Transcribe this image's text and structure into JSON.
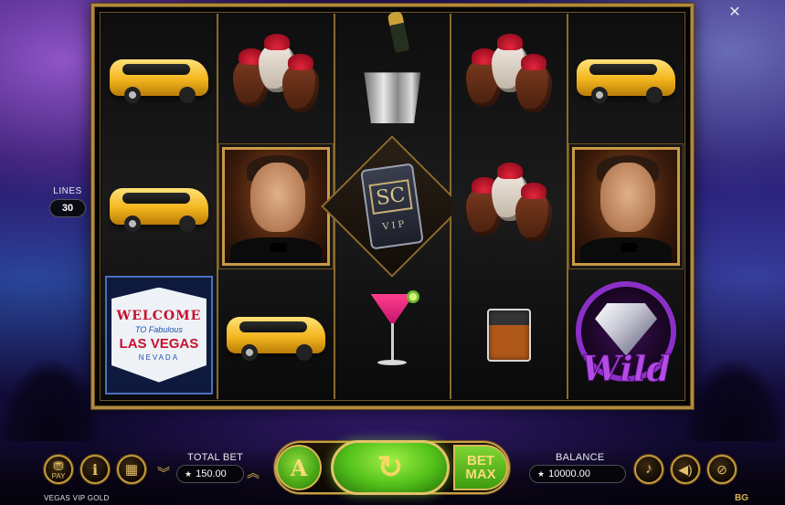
{
  "game": {
    "title": "VEGAS VIP GOLD",
    "studio_logo": "BG",
    "close_label": "✕"
  },
  "reels": [
    [
      "yellow-limousine",
      "yellow-limousine",
      "las-vegas-welcome-sign"
    ],
    [
      "chocolate-strawberries",
      "vip-man-portrait",
      "yellow-limousine"
    ],
    [
      "champagne-bucket",
      "sc-vip-card",
      "pink-cocktail"
    ],
    [
      "chocolate-strawberries",
      "chocolate-strawberries",
      "whisky-glass"
    ],
    [
      "yellow-limousine",
      "vip-man-portrait",
      "wild-diamond"
    ]
  ],
  "symbols": {
    "vegas": {
      "welcome": "WELCOME",
      "to_fabulous": "TO Fabulous",
      "las_vegas": "LAS VEGAS",
      "nevada": "NEVADA"
    },
    "sc": {
      "monogram": "SC",
      "vip": "VIP"
    },
    "wild": {
      "text": "Wild"
    }
  },
  "lines": {
    "label": "LINES",
    "value": "30"
  },
  "controls": {
    "paytable_label": "PAY",
    "info_icon": "info-icon",
    "cards_icon": "cards-icon",
    "total_bet_label": "TOTAL BET",
    "total_bet_value": "150.00",
    "autoplay_icon": "autoplay-icon",
    "spin_icon": "spin-icon",
    "bet_max_line1": "BET",
    "bet_max_line2": "MAX",
    "balance_label": "BALANCE",
    "balance_value": "10000.00",
    "music_icon": "music-note-icon",
    "sound_icon": "speaker-icon",
    "turbo_icon": "turbo-icon"
  },
  "colors": {
    "gold": "#c9a045",
    "spin_green": "#52c01a",
    "wild_purple": "#b54be6",
    "limo_yellow": "#f3b51d"
  }
}
